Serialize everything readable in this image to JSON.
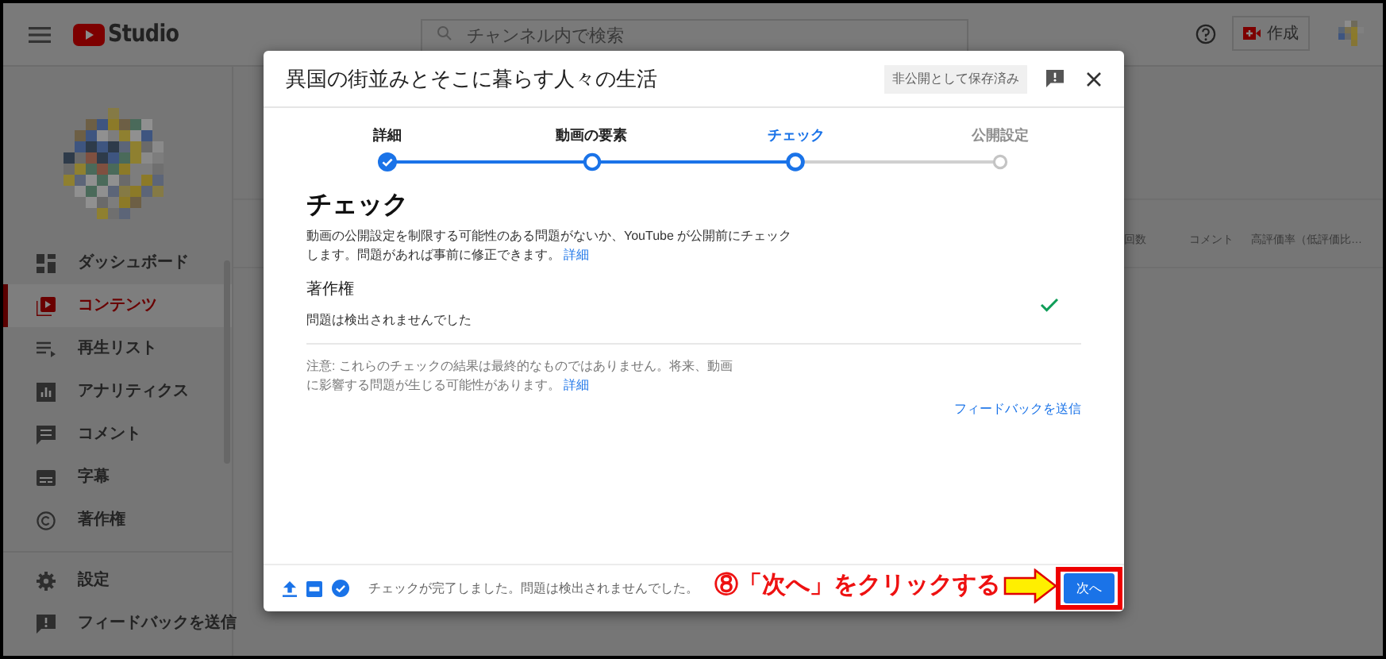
{
  "header": {
    "logo_text": "Studio",
    "search_placeholder": "チャンネル内で検索",
    "create_label": "作成"
  },
  "sidebar": {
    "items": [
      {
        "label": "ダッシュボード",
        "selected": false
      },
      {
        "label": "コンテンツ",
        "selected": true
      },
      {
        "label": "再生リスト",
        "selected": false
      },
      {
        "label": "アナリティクス",
        "selected": false
      },
      {
        "label": "コメント",
        "selected": false
      },
      {
        "label": "字幕",
        "selected": false
      },
      {
        "label": "著作権",
        "selected": false
      }
    ],
    "footer_items": [
      {
        "label": "設定"
      },
      {
        "label": "フィードバックを送信"
      }
    ]
  },
  "table": {
    "columns": [
      "回数",
      "コメント",
      "高評価率（低評価比…"
    ]
  },
  "dialog": {
    "title": "異国の街並みとそこに暮らす人々の生活",
    "saved_badge": "非公開として保存済み",
    "steps": [
      {
        "label": "詳細",
        "completed": true,
        "checked": true,
        "selected": false
      },
      {
        "label": "動画の要素",
        "completed": true,
        "checked": false,
        "selected": false
      },
      {
        "label": "チェック",
        "completed": false,
        "checked": false,
        "selected": true
      },
      {
        "label": "公開設定",
        "completed": false,
        "checked": false,
        "selected": false
      }
    ],
    "heading": "チェック",
    "description": "動画の公開設定を制限する可能性のある問題がないか、YouTube が公開前にチェックします。問題があれば事前に修正できます。",
    "description_link": "詳細",
    "section": {
      "title": "著作権",
      "result": "問題は検出されませんでした",
      "passed": true
    },
    "note": "注意: これらのチェックの結果は最終的なものではありません。将来、動画に影響する問題が生じる可能性があります。",
    "note_link": "詳細",
    "feedback_link": "フィードバックを送信",
    "footer_status": "チェックが完了しました。問題は検出されませんでした。",
    "next_button": "次へ"
  },
  "annotation": {
    "text": "⑧「次へ」をクリックする"
  }
}
